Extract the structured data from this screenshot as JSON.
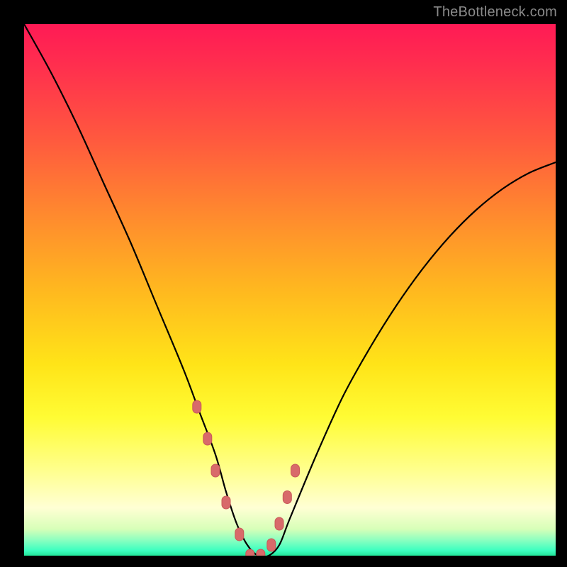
{
  "watermark": "TheBottleneck.com",
  "colors": {
    "gradient_top": "#ff1a55",
    "gradient_mid_orange": "#ff8a2e",
    "gradient_yellow": "#fffc34",
    "gradient_bottom_green": "#22e69a",
    "curve_stroke": "#000000",
    "marker_fill": "#d86a6a",
    "marker_stroke": "#c95858",
    "frame_bg": "#000000"
  },
  "chart_data": {
    "type": "line",
    "title": "",
    "xlabel": "",
    "ylabel": "",
    "xlim": [
      0,
      100
    ],
    "ylim": [
      0,
      100
    ],
    "grid": false,
    "legend": false,
    "x": [
      0,
      5,
      10,
      15,
      20,
      25,
      30,
      33,
      36,
      38,
      40,
      42,
      44,
      46,
      48,
      50,
      55,
      60,
      65,
      70,
      75,
      80,
      85,
      90,
      95,
      100
    ],
    "values": [
      100,
      91,
      81,
      70,
      59,
      47,
      35,
      27,
      19,
      12,
      6,
      2,
      0,
      0,
      2,
      7,
      19,
      30,
      39,
      47,
      54,
      60,
      65,
      69,
      72,
      74
    ],
    "markers": {
      "x": [
        32.5,
        34.5,
        36.0,
        38.0,
        40.5,
        42.5,
        44.5,
        46.5,
        48.0,
        49.5,
        51.0
      ],
      "y": [
        28,
        22,
        16,
        10,
        4,
        0,
        0,
        2,
        6,
        11,
        16
      ]
    }
  }
}
